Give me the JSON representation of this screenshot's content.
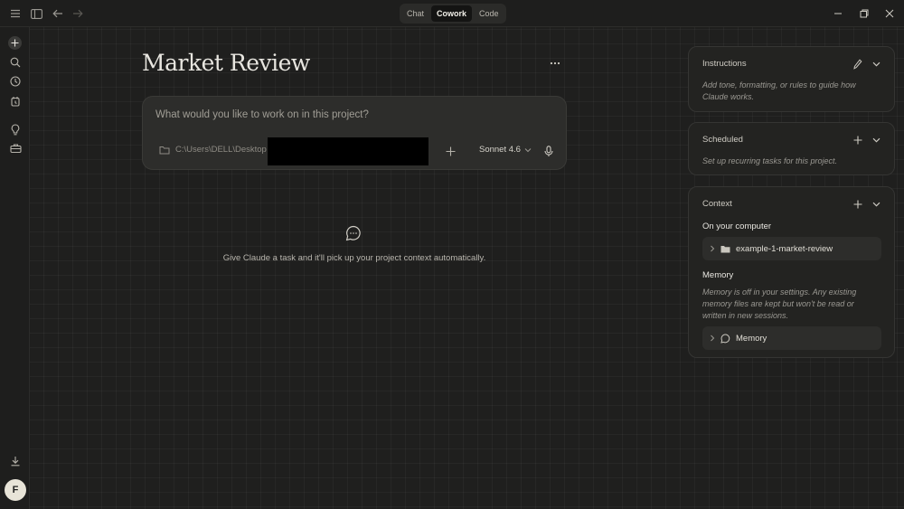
{
  "titlebar": {
    "modes": [
      {
        "label": "Chat",
        "active": false
      },
      {
        "label": "Cowork",
        "active": true
      },
      {
        "label": "Code",
        "active": false
      }
    ]
  },
  "user": {
    "avatar_initial": "F"
  },
  "project": {
    "title": "Market Review"
  },
  "composer": {
    "prompt": "What would you like to work on in this project?",
    "path": "C:\\Users\\DELL\\Desktop",
    "model": "Sonnet 4.6"
  },
  "empty_state": {
    "message": "Give Claude a task and it'll pick up your project context automatically."
  },
  "instructions": {
    "title": "Instructions",
    "description_line1": "Add tone, formatting, or rules to guide how",
    "description_line2": "Claude works."
  },
  "scheduled": {
    "title": "Scheduled",
    "description": "Set up recurring tasks for this project."
  },
  "context": {
    "title": "Context",
    "computer_heading": "On your computer",
    "folder_name": "example-1-market-review",
    "memory_heading": "Memory",
    "memory_line1": "Memory is off in your settings. Any existing",
    "memory_line2": "memory files are kept but won't be read or",
    "memory_line3": "written in new sessions.",
    "memory_item": "Memory"
  },
  "colors": {
    "background": "#1f1f1e",
    "panel": "#232321",
    "composer": "#2d2d2b",
    "accent_text": "#e8e6e0"
  }
}
